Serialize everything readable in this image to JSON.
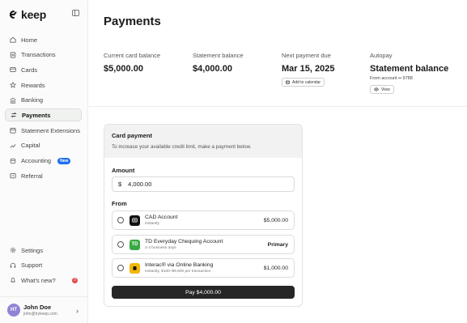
{
  "brand": {
    "name": "keep"
  },
  "sidebar": {
    "items": [
      {
        "label": "Home",
        "icon": "home-icon"
      },
      {
        "label": "Transactions",
        "icon": "transactions-icon"
      },
      {
        "label": "Cards",
        "icon": "card-icon"
      },
      {
        "label": "Rewards",
        "icon": "star-icon"
      },
      {
        "label": "Banking",
        "icon": "bank-icon"
      },
      {
        "label": "Payments",
        "icon": "swap-icon",
        "active": true
      },
      {
        "label": "Statement Extensions",
        "icon": "calendar-icon"
      },
      {
        "label": "Capital",
        "icon": "capital-icon"
      },
      {
        "label": "Accounting",
        "icon": "coins-icon",
        "badge": "New"
      },
      {
        "label": "Referral",
        "icon": "referral-icon"
      }
    ],
    "bottom_items": [
      {
        "label": "Settings",
        "icon": "gear-icon"
      },
      {
        "label": "Support",
        "icon": "headset-icon"
      },
      {
        "label": "What's new?",
        "icon": "bell-icon",
        "count": "3"
      }
    ],
    "user": {
      "initials": "HT",
      "name": "John Doe",
      "email": "john@trykeep.com"
    }
  },
  "page": {
    "title": "Payments"
  },
  "stats": {
    "current_balance": {
      "label": "Current card balance",
      "value": "$5,000.00"
    },
    "statement_balance": {
      "label": "Statement balance",
      "value": "$4,000.00"
    },
    "next_due": {
      "label": "Next payment due",
      "value": "Mar 15, 2025",
      "action": "Add to calendar"
    },
    "autopay": {
      "label": "Autopay",
      "value": "Statement balance",
      "sub": "From account •• 9788",
      "action": "View"
    }
  },
  "payment_card": {
    "title": "Card payment",
    "subtitle": "To increase your available credit limit, make a payment below.",
    "amount_label": "Amount",
    "currency_symbol": "$",
    "amount_value": "4,000.00",
    "from_label": "From",
    "options": [
      {
        "name": "CAD Account",
        "desc": "Instantly",
        "right": "$5,000.00",
        "color": "#111111",
        "glyph": "□"
      },
      {
        "name": "TD Everyday Chequing Account",
        "desc": "2-4 business days",
        "right": "Primary",
        "color": "#3aa845",
        "glyph": "TD"
      },
      {
        "name": "Interac® via Online Banking",
        "desc": "Instantly, $100–$9,800 per transaction",
        "right": "$1,000.00",
        "color": "#f2b705",
        "glyph": "i"
      }
    ],
    "pay_button": "Pay $4,000.00"
  },
  "colors": {
    "accent": "#1d6ef0",
    "button_dark": "#262626",
    "alert": "#e5484d"
  }
}
